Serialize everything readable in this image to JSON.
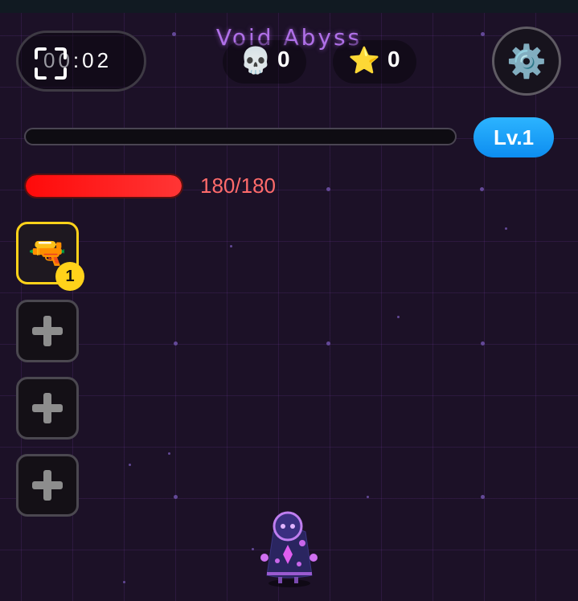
{
  "game": {
    "title": "Void Abyss"
  },
  "timer": {
    "dim_text": "00",
    "text": ":02"
  },
  "stats": {
    "kills": "0",
    "stars": "0"
  },
  "icons": {
    "kills": "💀",
    "stars": "⭐",
    "settings": "⚙️",
    "weapon": "🔫",
    "screenshot": "screenshot-frame-icon",
    "empty_slot": "plus-icon"
  },
  "level": {
    "label": "Lv.1",
    "xp_progress": 0.0
  },
  "health": {
    "text": "180/180",
    "current": 180,
    "max": 180
  },
  "weapon_slots": [
    {
      "state": "equipped",
      "level": "1"
    },
    {
      "state": "empty"
    },
    {
      "state": "empty"
    },
    {
      "state": "empty"
    }
  ],
  "colors": {
    "background": "#1c1127",
    "title": "#b070e8",
    "hp": "#ff1a1a",
    "hp_text": "#ff6b6b",
    "level_badge": "#1aa0ff",
    "slot_active": "#ffd21a"
  }
}
